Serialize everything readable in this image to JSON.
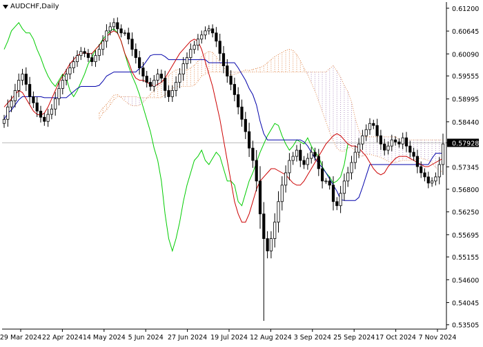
{
  "chart_data": {
    "type": "candlestick",
    "title": "AUDCHF,Daily",
    "current_price": "0.57928",
    "y_ticks": [
      "0.61200",
      "0.60645",
      "0.60090",
      "0.59555",
      "0.58995",
      "0.58440",
      "0.57928",
      "0.57345",
      "0.56800",
      "0.56250",
      "0.55695",
      "0.55155",
      "0.54600",
      "0.54045",
      "0.53505"
    ],
    "ylim": [
      0.534,
      0.6135
    ],
    "x_ticks": [
      "29 Mar 2024",
      "22 Apr 2024",
      "14 May 2024",
      "5 Jun 2024",
      "27 Jun 2024",
      "19 Jul 2024",
      "12 Aug 2024",
      "3 Sep 2024",
      "25 Sep 2024",
      "17 Oct 2024",
      "7 Nov 2024"
    ],
    "indicators": [
      "Tenkan-sen",
      "Kijun-sen",
      "Chikou Span",
      "Senkou Span A",
      "Senkou Span B"
    ],
    "colors": {
      "candle": "#000000",
      "tenkan": "#cc0000",
      "kijun": "#0000aa",
      "chikou": "#00cc00",
      "cloud": "#e08a50",
      "cloud_alt": "#b090c0",
      "price_line": "#bbbbbb",
      "axis": "#000000"
    },
    "closes": [
      0.585,
      0.588,
      0.5895,
      0.592,
      0.5945,
      0.596,
      0.5935,
      0.5905,
      0.589,
      0.587,
      0.5855,
      0.5845,
      0.5862,
      0.5875,
      0.59,
      0.5925,
      0.5945,
      0.596,
      0.5975,
      0.599,
      0.6005,
      0.6015,
      0.601,
      0.6,
      0.599,
      0.6005,
      0.602,
      0.604,
      0.6065,
      0.6075,
      0.6085,
      0.607,
      0.606,
      0.606,
      0.6045,
      0.602,
      0.6,
      0.5975,
      0.5955,
      0.594,
      0.593,
      0.5945,
      0.596,
      0.595,
      0.592,
      0.5905,
      0.592,
      0.594,
      0.596,
      0.5985,
      0.6,
      0.602,
      0.603,
      0.6045,
      0.6055,
      0.6065,
      0.607,
      0.606,
      0.604,
      0.601,
      0.598,
      0.5955,
      0.5935,
      0.591,
      0.588,
      0.585,
      0.582,
      0.578,
      0.575,
      0.57,
      0.562,
      0.556,
      0.553,
      0.556,
      0.56,
      0.565,
      0.569,
      0.572,
      0.575,
      0.576,
      0.5775,
      0.575,
      0.574,
      0.5755,
      0.577,
      0.576,
      0.573,
      0.57,
      0.57,
      0.569,
      0.565,
      0.564,
      0.567,
      0.57,
      0.572,
      0.5745,
      0.577,
      0.579,
      0.581,
      0.5825,
      0.584,
      0.5835,
      0.581,
      0.579,
      0.5775,
      0.5785,
      0.58,
      0.5795,
      0.579,
      0.5805,
      0.5785,
      0.577,
      0.576,
      0.5735,
      0.572,
      0.571,
      0.5695,
      0.57,
      0.571,
      0.574,
      0.579
    ],
    "tenkan": [
      0.588,
      0.589,
      0.59,
      0.591,
      0.592,
      0.5915,
      0.59,
      0.5885,
      0.587,
      0.5862,
      0.586,
      0.5865,
      0.588,
      0.59,
      0.592,
      0.594,
      0.5955,
      0.597,
      0.5985,
      0.5995,
      0.6005,
      0.601,
      0.6012,
      0.601,
      0.601,
      0.602,
      0.603,
      0.604,
      0.605,
      0.606,
      0.6065,
      0.606,
      0.604,
      0.601,
      0.599,
      0.5965,
      0.595,
      0.5945,
      0.5945,
      0.594,
      0.5935,
      0.593,
      0.5935,
      0.594,
      0.595,
      0.5965,
      0.598,
      0.5995,
      0.601,
      0.602,
      0.603,
      0.604,
      0.6045,
      0.604,
      0.602,
      0.599,
      0.596,
      0.593,
      0.589,
      0.585,
      0.58,
      0.575,
      0.57,
      0.565,
      0.562,
      0.56,
      0.56,
      0.562,
      0.565,
      0.568,
      0.57,
      0.571,
      0.572,
      0.573,
      0.573,
      0.5725,
      0.572,
      0.5715,
      0.5705,
      0.5695,
      0.569,
      0.569,
      0.57,
      0.5715,
      0.573,
      0.5745,
      0.576,
      0.5775,
      0.579,
      0.58,
      0.581,
      0.5815,
      0.581,
      0.58,
      0.579,
      0.5785,
      0.5785,
      0.578,
      0.577,
      0.576,
      0.5745,
      0.573,
      0.572,
      0.5715,
      0.572,
      0.5735,
      0.5745,
      0.5755,
      0.576,
      0.576,
      0.576,
      0.5755,
      0.575,
      0.5745,
      0.574,
      0.5735,
      0.5735,
      0.574,
      0.5745,
      0.575,
      0.5755
    ]
  }
}
